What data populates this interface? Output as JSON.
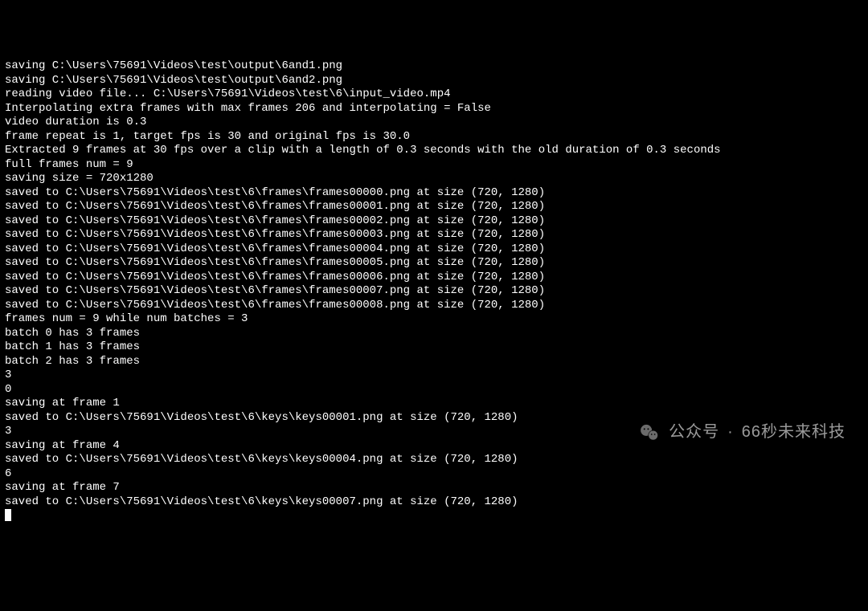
{
  "terminal": {
    "lines": [
      "saving C:\\Users\\75691\\Videos\\test\\output\\6and1.png",
      "saving C:\\Users\\75691\\Videos\\test\\output\\6and2.png",
      "reading video file... C:\\Users\\75691\\Videos\\test\\6\\input_video.mp4",
      "Interpolating extra frames with max frames 206 and interpolating = False",
      "video duration is 0.3",
      "frame repeat is 1, target fps is 30 and original fps is 30.0",
      "Extracted 9 frames at 30 fps over a clip with a length of 0.3 seconds with the old duration of 0.3 seconds",
      "full frames num = 9",
      "saving size = 720x1280",
      "saved to C:\\Users\\75691\\Videos\\test\\6\\frames\\frames00000.png at size (720, 1280)",
      "saved to C:\\Users\\75691\\Videos\\test\\6\\frames\\frames00001.png at size (720, 1280)",
      "saved to C:\\Users\\75691\\Videos\\test\\6\\frames\\frames00002.png at size (720, 1280)",
      "saved to C:\\Users\\75691\\Videos\\test\\6\\frames\\frames00003.png at size (720, 1280)",
      "saved to C:\\Users\\75691\\Videos\\test\\6\\frames\\frames00004.png at size (720, 1280)",
      "saved to C:\\Users\\75691\\Videos\\test\\6\\frames\\frames00005.png at size (720, 1280)",
      "saved to C:\\Users\\75691\\Videos\\test\\6\\frames\\frames00006.png at size (720, 1280)",
      "saved to C:\\Users\\75691\\Videos\\test\\6\\frames\\frames00007.png at size (720, 1280)",
      "saved to C:\\Users\\75691\\Videos\\test\\6\\frames\\frames00008.png at size (720, 1280)",
      "frames num = 9 while num batches = 3",
      "batch 0 has 3 frames",
      "batch 1 has 3 frames",
      "batch 2 has 3 frames",
      "3",
      "0",
      "saving at frame 1",
      "saved to C:\\Users\\75691\\Videos\\test\\6\\keys\\keys00001.png at size (720, 1280)",
      "3",
      "saving at frame 4",
      "saved to C:\\Users\\75691\\Videos\\test\\6\\keys\\keys00004.png at size (720, 1280)",
      "6",
      "saving at frame 7",
      "saved to C:\\Users\\75691\\Videos\\test\\6\\keys\\keys00007.png at size (720, 1280)"
    ]
  },
  "watermark": {
    "prefix": "公众号",
    "dot": "·",
    "name": "66秒未来科技"
  }
}
